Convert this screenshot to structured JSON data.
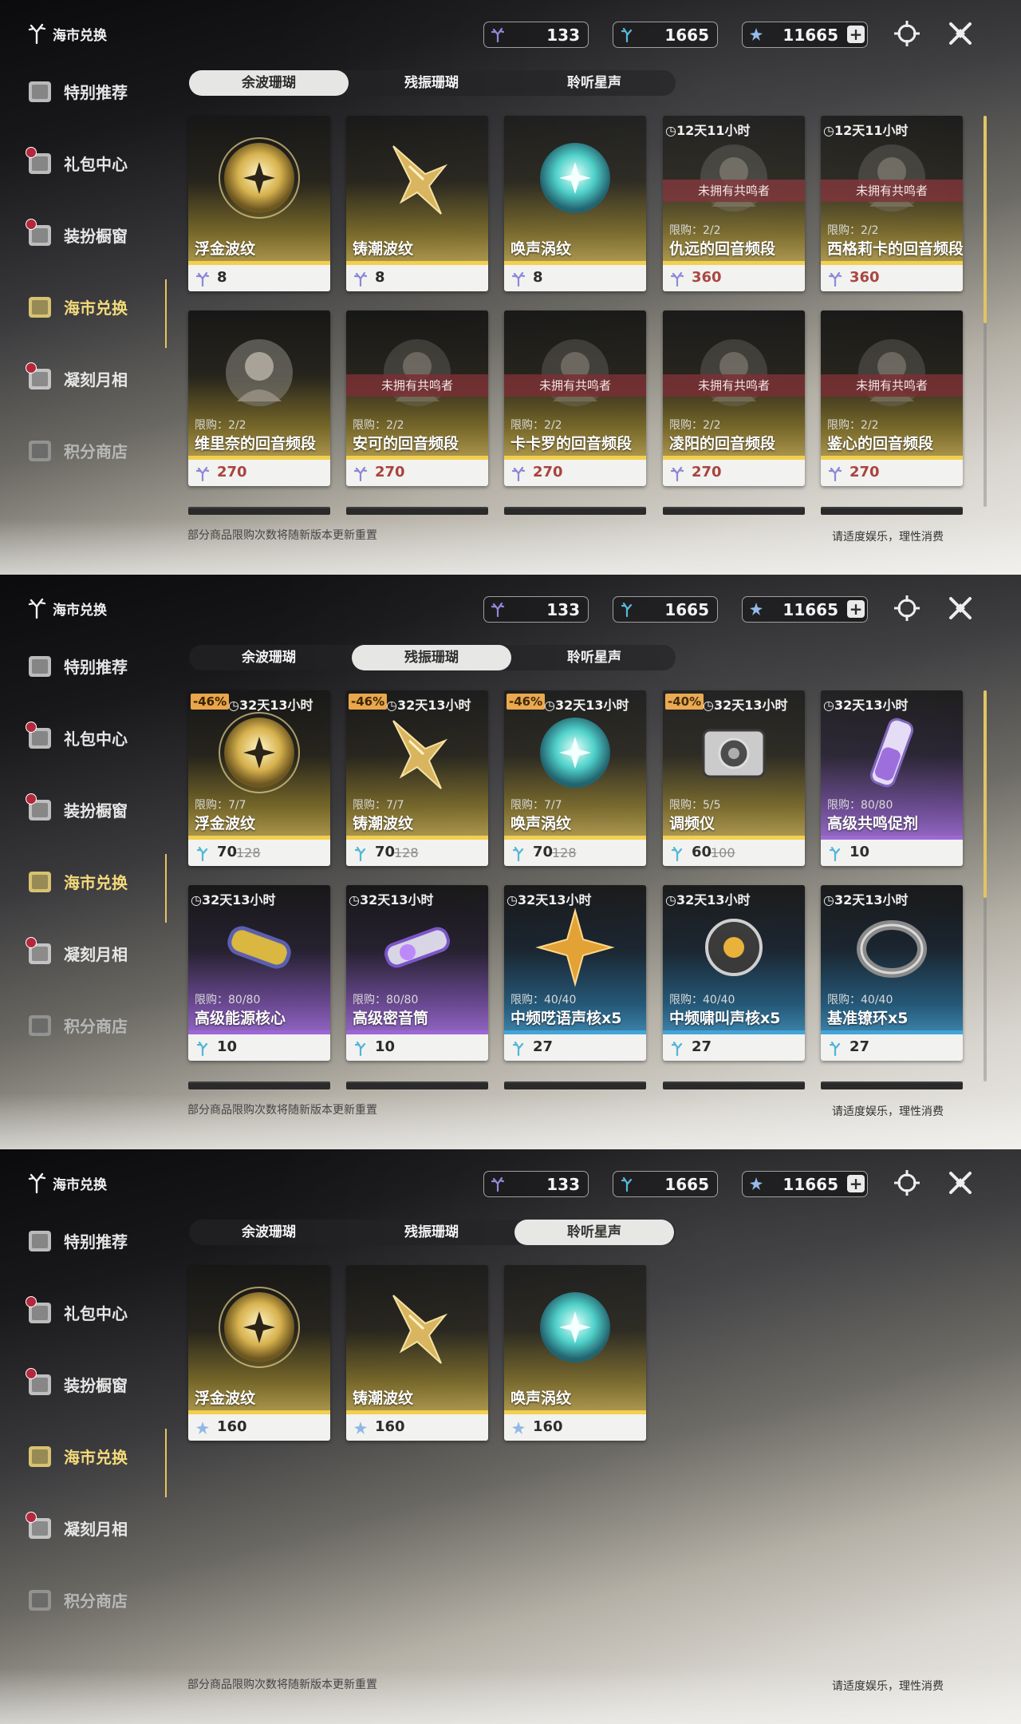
{
  "brand": "海市兑换",
  "sidebar": {
    "items": [
      {
        "label": "特别推荐",
        "dot": false
      },
      {
        "label": "礼包中心",
        "dot": true
      },
      {
        "label": "装扮橱窗",
        "dot": true
      },
      {
        "label": "海市兑换",
        "dot": false,
        "active": true
      },
      {
        "label": "凝刻月相",
        "dot": true
      },
      {
        "label": "积分商店",
        "dot": false,
        "dim": true
      }
    ]
  },
  "currencies": {
    "c1": "133",
    "c2": "1665",
    "c3": "11665"
  },
  "tabs": [
    "余波珊瑚",
    "残振珊瑚",
    "聆听星声"
  ],
  "footer": {
    "note": "部分商品限购次数将随新版本更新重置",
    "tip": "请适度娱乐，理性消费"
  },
  "colors": {
    "accent": "#f3da7a",
    "gold": "#f2cf4c",
    "purple": "#9c66d6",
    "blue": "#43a4d8",
    "price_red": "#a9433e"
  },
  "panel1": {
    "selected_tab": 0,
    "cards": [
      {
        "name": "浮金波纹",
        "price": "8",
        "rarity": "gold",
        "icon": "gold-orb-icon",
        "currency": "coral-icon"
      },
      {
        "name": "铸潮波纹",
        "price": "8",
        "rarity": "gold",
        "icon": "gold-blade-icon",
        "currency": "coral-icon"
      },
      {
        "name": "唤声涡纹",
        "price": "8",
        "rarity": "gold",
        "icon": "teal-orb-icon",
        "currency": "coral-icon"
      },
      {
        "name": "仇远的回音频段",
        "price": "360",
        "rarity": "gold",
        "timer": "12天11小时",
        "limit": "限购：2/2",
        "unowned": "未拥有共鸣者",
        "icon": "character-portrait-icon",
        "currency": "coral-icon"
      },
      {
        "name": "西格莉卡的回音频段",
        "price": "360",
        "rarity": "gold",
        "timer": "12天11小时",
        "limit": "限购：2/2",
        "unowned": "未拥有共鸣者",
        "icon": "character-portrait-icon",
        "currency": "coral-icon"
      },
      {
        "name": "维里奈的回音频段",
        "price": "270",
        "rarity": "gold",
        "limit": "限购：2/2",
        "icon": "character-portrait-icon",
        "currency": "coral-icon"
      },
      {
        "name": "安可的回音频段",
        "price": "270",
        "rarity": "gold",
        "limit": "限购：2/2",
        "unowned": "未拥有共鸣者",
        "icon": "character-portrait-icon",
        "currency": "coral-icon"
      },
      {
        "name": "卡卡罗的回音频段",
        "price": "270",
        "rarity": "gold",
        "limit": "限购：2/2",
        "unowned": "未拥有共鸣者",
        "icon": "character-portrait-icon",
        "currency": "coral-icon"
      },
      {
        "name": "凌阳的回音频段",
        "price": "270",
        "rarity": "gold",
        "limit": "限购：2/2",
        "unowned": "未拥有共鸣者",
        "icon": "character-portrait-icon",
        "currency": "coral-icon"
      },
      {
        "name": "鉴心的回音频段",
        "price": "270",
        "rarity": "gold",
        "limit": "限购：2/2",
        "unowned": "未拥有共鸣者",
        "icon": "character-portrait-icon",
        "currency": "coral-icon"
      }
    ]
  },
  "panel2": {
    "selected_tab": 1,
    "cards": [
      {
        "name": "浮金波纹",
        "price": "70",
        "old": "128",
        "discount": "-46%",
        "timer": "32天13小时",
        "limit": "限购：7/7",
        "rarity": "gold",
        "icon": "gold-orb-icon",
        "currency": "oscillated-coral-icon"
      },
      {
        "name": "铸潮波纹",
        "price": "70",
        "old": "128",
        "discount": "-46%",
        "timer": "32天13小时",
        "limit": "限购：7/7",
        "rarity": "gold",
        "icon": "gold-blade-icon",
        "currency": "oscillated-coral-icon"
      },
      {
        "name": "唤声涡纹",
        "price": "70",
        "old": "128",
        "discount": "-46%",
        "timer": "32天13小时",
        "limit": "限购：7/7",
        "rarity": "gold",
        "icon": "teal-orb-icon",
        "currency": "oscillated-coral-icon"
      },
      {
        "name": "调频仪",
        "price": "60",
        "old": "100",
        "discount": "-40%",
        "timer": "32天13小时",
        "limit": "限购：5/5",
        "rarity": "gold",
        "icon": "tuner-device-icon",
        "currency": "oscillated-coral-icon"
      },
      {
        "name": "高级共鸣促剂",
        "price": "10",
        "timer": "32天13小时",
        "limit": "限购：80/80",
        "rarity": "purple",
        "icon": "vial-icon",
        "currency": "oscillated-coral-icon"
      },
      {
        "name": "高级能源核心",
        "price": "10",
        "timer": "32天13小时",
        "limit": "限购：80/80",
        "rarity": "purple",
        "icon": "energy-core-icon",
        "currency": "oscillated-coral-icon"
      },
      {
        "name": "高级密音筒",
        "price": "10",
        "timer": "32天13小时",
        "limit": "限购：80/80",
        "rarity": "purple",
        "icon": "sealed-tube-icon",
        "currency": "oscillated-coral-icon"
      },
      {
        "name": "中频呓语声核x5",
        "price": "27",
        "timer": "32天13小时",
        "limit": "限购：40/40",
        "rarity": "blue",
        "icon": "star-core-icon",
        "currency": "oscillated-coral-icon"
      },
      {
        "name": "中频啸叫声核x5",
        "price": "27",
        "timer": "32天13小时",
        "limit": "限购：40/40",
        "rarity": "blue",
        "icon": "dark-core-icon",
        "currency": "oscillated-coral-icon"
      },
      {
        "name": "基准镣环x5",
        "price": "27",
        "timer": "32天13小时",
        "limit": "限购：40/40",
        "rarity": "blue",
        "icon": "ring-icon",
        "currency": "oscillated-coral-icon"
      }
    ]
  },
  "panel3": {
    "selected_tab": 2,
    "cards": [
      {
        "name": "浮金波纹",
        "price": "160",
        "rarity": "gold",
        "icon": "gold-orb-icon",
        "currency": "star-sound-icon"
      },
      {
        "name": "铸潮波纹",
        "price": "160",
        "rarity": "gold",
        "icon": "gold-blade-icon",
        "currency": "star-sound-icon"
      },
      {
        "name": "唤声涡纹",
        "price": "160",
        "rarity": "gold",
        "icon": "teal-orb-icon",
        "currency": "star-sound-icon"
      }
    ]
  }
}
